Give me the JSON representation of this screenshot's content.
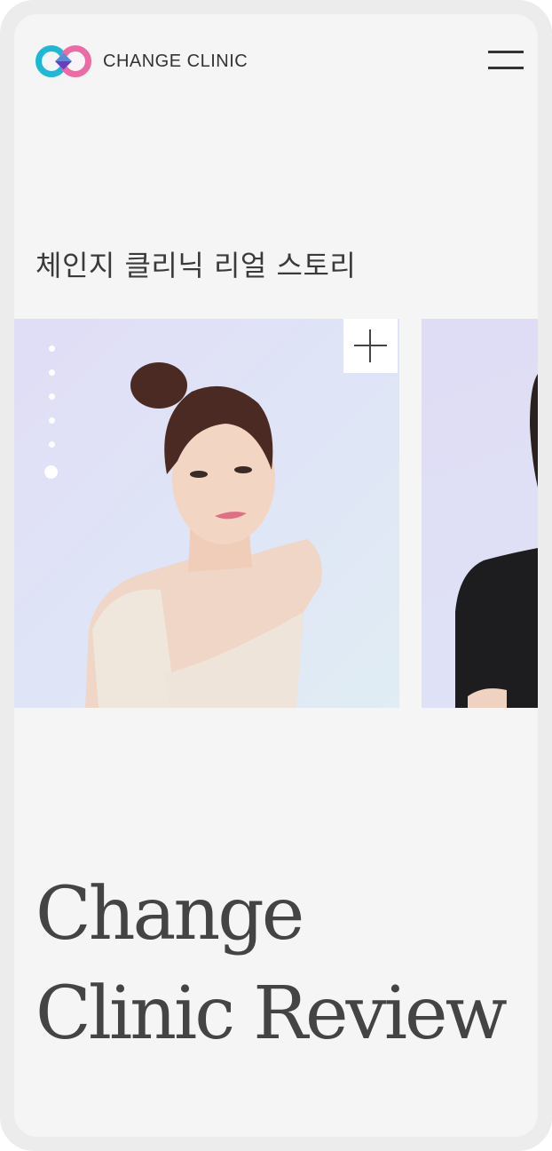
{
  "brand": {
    "name": "CHANGE CLINIC",
    "colors": {
      "cyan": "#1cb8d6",
      "pink": "#ec6aa6",
      "purple": "#6a3cc2"
    }
  },
  "header": {
    "menu_icon": "hamburger-icon"
  },
  "section": {
    "title": "체인지 클리닉 리얼 스토리"
  },
  "slider": {
    "dots_count": 6,
    "active_dot": 6,
    "plus_icon": "plus-icon",
    "slides": [
      {
        "subject": "woman in cream dress portrait"
      },
      {
        "subject": "woman in black top portrait (partial)"
      }
    ]
  },
  "headline": {
    "line1": "Change",
    "line2": "Clinic Review"
  }
}
